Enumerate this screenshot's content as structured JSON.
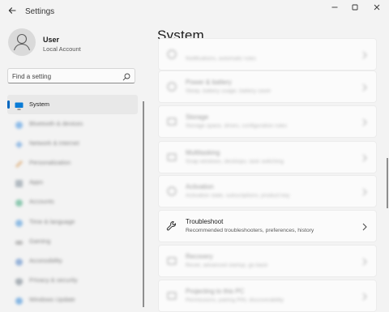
{
  "window": {
    "title": "Settings",
    "back_icon": "back-arrow-icon",
    "controls": [
      "minimize-icon",
      "maximize-icon",
      "close-icon"
    ]
  },
  "user": {
    "name": "User",
    "account_type": "Local Account"
  },
  "search": {
    "placeholder": "Find a setting",
    "value": ""
  },
  "nav": {
    "items": [
      {
        "label": "System",
        "icon": "monitor-icon",
        "active": true
      },
      {
        "label": "Bluetooth & devices",
        "icon": "bluetooth-icon"
      },
      {
        "label": "Network & internet",
        "icon": "network-icon"
      },
      {
        "label": "Personalization",
        "icon": "brush-icon"
      },
      {
        "label": "Apps",
        "icon": "apps-icon"
      },
      {
        "label": "Accounts",
        "icon": "accounts-icon"
      },
      {
        "label": "Time & language",
        "icon": "clock-icon"
      },
      {
        "label": "Gaming",
        "icon": "gaming-icon"
      },
      {
        "label": "Accessibility",
        "icon": "accessibility-icon"
      },
      {
        "label": "Privacy & security",
        "icon": "shield-icon"
      },
      {
        "label": "Windows Update",
        "icon": "update-icon"
      }
    ]
  },
  "main": {
    "title": "System",
    "cards": [
      {
        "title": "",
        "subtitle": "Notifications, automatic rules",
        "icon": "notifications-icon",
        "blurred": true
      },
      {
        "title": "Power & battery",
        "subtitle": "Sleep, battery usage, battery saver",
        "icon": "power-icon",
        "blurred": true
      },
      {
        "title": "Storage",
        "subtitle": "Storage space, drives, configuration rules",
        "icon": "storage-icon",
        "blurred": true
      },
      {
        "title": "Multitasking",
        "subtitle": "Snap windows, desktops, task switching",
        "icon": "multitasking-icon",
        "blurred": true
      },
      {
        "title": "Activation",
        "subtitle": "Activation state, subscriptions, product key",
        "icon": "activation-icon",
        "blurred": true
      },
      {
        "title": "Troubleshoot",
        "subtitle": "Recommended troubleshooters, preferences, history",
        "icon": "wrench-icon",
        "blurred": false
      },
      {
        "title": "Recovery",
        "subtitle": "Reset, advanced startup, go back",
        "icon": "recovery-icon",
        "blurred": true
      },
      {
        "title": "Projecting to this PC",
        "subtitle": "Permissions, pairing PIN, discoverability",
        "icon": "projecting-icon",
        "blurred": true
      }
    ]
  },
  "colors": {
    "accent": "#0067c0",
    "background": "#f3f3f3",
    "card": "#fbfbfb"
  }
}
